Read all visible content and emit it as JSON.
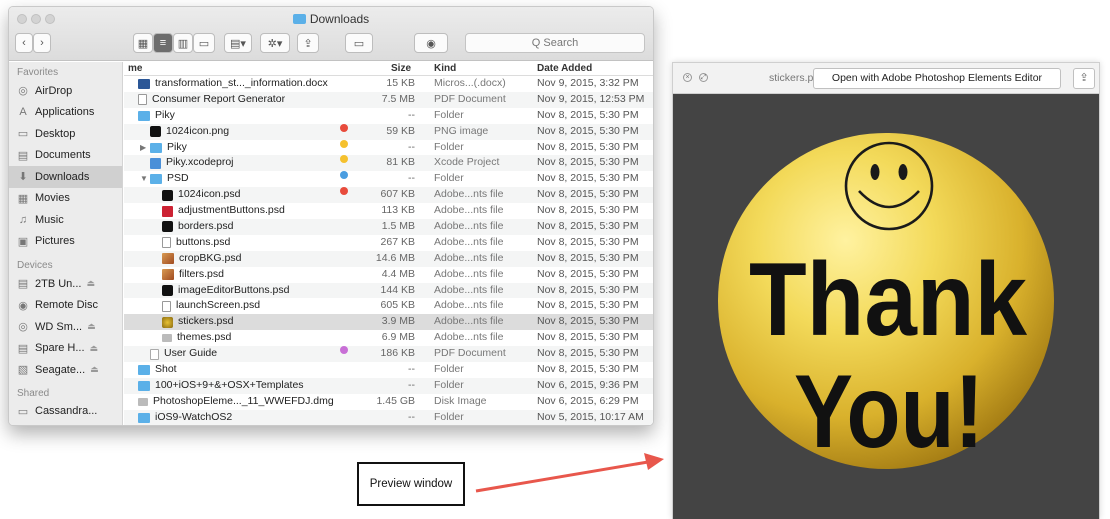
{
  "finder": {
    "title": "Downloads",
    "search_placeholder": "Q Search",
    "sidebar": {
      "favorites_label": "Favorites",
      "favorites": [
        {
          "label": "AirDrop",
          "icon": "airdrop-icon",
          "glyph": "◎"
        },
        {
          "label": "Applications",
          "icon": "applications-icon",
          "glyph": "A"
        },
        {
          "label": "Desktop",
          "icon": "desktop-icon",
          "glyph": "▭"
        },
        {
          "label": "Documents",
          "icon": "documents-icon",
          "glyph": "▤"
        },
        {
          "label": "Downloads",
          "icon": "downloads-icon",
          "glyph": "⬇",
          "selected": true
        },
        {
          "label": "Movies",
          "icon": "movies-icon",
          "glyph": "▦"
        },
        {
          "label": "Music",
          "icon": "music-icon",
          "glyph": "♫"
        },
        {
          "label": "Pictures",
          "icon": "pictures-icon",
          "glyph": "▣"
        }
      ],
      "devices_label": "Devices",
      "devices": [
        {
          "label": "2TB Un...",
          "icon": "drive-icon",
          "glyph": "▤",
          "eject": true
        },
        {
          "label": "Remote Disc",
          "icon": "remote-disc-icon",
          "glyph": "◉",
          "eject": false
        },
        {
          "label": "WD Sm...",
          "icon": "drive-icon",
          "glyph": "◎",
          "eject": true
        },
        {
          "label": "Spare H...",
          "icon": "drive-icon",
          "glyph": "▤",
          "eject": true
        },
        {
          "label": "Seagate...",
          "icon": "drive-icon",
          "glyph": "▧",
          "eject": true
        }
      ],
      "shared_label": "Shared",
      "shared": [
        {
          "label": "Cassandra...",
          "icon": "computer-icon",
          "glyph": "▭"
        }
      ]
    },
    "columns": {
      "name": "me",
      "size": "Size",
      "kind": "Kind",
      "date": "Date Added"
    },
    "rows": [
      {
        "indent": 0,
        "disc": "",
        "icon": "word",
        "name": "transformation_st..._information.docx",
        "size": "15 KB",
        "kind": "Micros...(.docx)",
        "date": "Nov 9, 2015, 3:32 PM",
        "tag": ""
      },
      {
        "indent": 0,
        "disc": "",
        "icon": "doc",
        "name": "Consumer Report Generator",
        "size": "7.5 MB",
        "kind": "PDF Document",
        "date": "Nov 9, 2015, 12:53 PM",
        "tag": ""
      },
      {
        "indent": 0,
        "disc": "",
        "icon": "folder",
        "name": "Piky",
        "size": "--",
        "kind": "Folder",
        "date": "Nov 8, 2015, 5:30 PM",
        "tag": ""
      },
      {
        "indent": 1,
        "disc": "",
        "icon": "dark",
        "name": "1024icon.png",
        "size": "59 KB",
        "kind": "PNG image",
        "date": "Nov 8, 2015, 5:30 PM",
        "tag": "#e84b3c"
      },
      {
        "indent": 1,
        "disc": "▶",
        "icon": "folder",
        "name": "Piky",
        "size": "--",
        "kind": "Folder",
        "date": "Nov 8, 2015, 5:30 PM",
        "tag": "#f5c12e"
      },
      {
        "indent": 1,
        "disc": "",
        "icon": "xcode",
        "name": "Piky.xcodeproj",
        "size": "81 KB",
        "kind": "Xcode Project",
        "date": "Nov 8, 2015, 5:30 PM",
        "tag": "#f5c12e"
      },
      {
        "indent": 1,
        "disc": "▼",
        "icon": "folder",
        "name": "PSD",
        "size": "--",
        "kind": "Folder",
        "date": "Nov 8, 2015, 5:30 PM",
        "tag": "#4a9de0"
      },
      {
        "indent": 2,
        "disc": "",
        "icon": "dark",
        "name": "1024icon.psd",
        "size": "607 KB",
        "kind": "Adobe...nts file",
        "date": "Nov 8, 2015, 5:30 PM",
        "tag": "#e84b3c"
      },
      {
        "indent": 2,
        "disc": "",
        "icon": "psd",
        "name": "adjustmentButtons.psd",
        "size": "113 KB",
        "kind": "Adobe...nts file",
        "date": "Nov 8, 2015, 5:30 PM",
        "tag": ""
      },
      {
        "indent": 2,
        "disc": "",
        "icon": "dark",
        "name": "borders.psd",
        "size": "1.5 MB",
        "kind": "Adobe...nts file",
        "date": "Nov 8, 2015, 5:30 PM",
        "tag": ""
      },
      {
        "indent": 2,
        "disc": "",
        "icon": "doc",
        "name": "buttons.psd",
        "size": "267 KB",
        "kind": "Adobe...nts file",
        "date": "Nov 8, 2015, 5:30 PM",
        "tag": ""
      },
      {
        "indent": 2,
        "disc": "",
        "icon": "photo",
        "name": "cropBKG.psd",
        "size": "14.6 MB",
        "kind": "Adobe...nts file",
        "date": "Nov 8, 2015, 5:30 PM",
        "tag": ""
      },
      {
        "indent": 2,
        "disc": "",
        "icon": "photo",
        "name": "filters.psd",
        "size": "4.4 MB",
        "kind": "Adobe...nts file",
        "date": "Nov 8, 2015, 5:30 PM",
        "tag": ""
      },
      {
        "indent": 2,
        "disc": "",
        "icon": "dark",
        "name": "imageEditorButtons.psd",
        "size": "144 KB",
        "kind": "Adobe...nts file",
        "date": "Nov 8, 2015, 5:30 PM",
        "tag": ""
      },
      {
        "indent": 2,
        "disc": "",
        "icon": "doc",
        "name": "launchScreen.psd",
        "size": "605 KB",
        "kind": "Adobe...nts file",
        "date": "Nov 8, 2015, 5:30 PM",
        "tag": ""
      },
      {
        "indent": 2,
        "disc": "",
        "icon": "gold",
        "name": "stickers.psd",
        "size": "3.9 MB",
        "kind": "Adobe...nts file",
        "date": "Nov 8, 2015, 5:30 PM",
        "tag": "",
        "selected": true
      },
      {
        "indent": 2,
        "disc": "",
        "icon": "dmg",
        "name": "themes.psd",
        "size": "6.9 MB",
        "kind": "Adobe...nts file",
        "date": "Nov 8, 2015, 5:30 PM",
        "tag": ""
      },
      {
        "indent": 1,
        "disc": "",
        "icon": "pdf",
        "name": "User Guide",
        "size": "186 KB",
        "kind": "PDF Document",
        "date": "Nov 8, 2015, 5:30 PM",
        "tag": "#c86fd6"
      },
      {
        "indent": 0,
        "disc": "",
        "icon": "folder",
        "name": "Shot",
        "size": "--",
        "kind": "Folder",
        "date": "Nov 8, 2015, 5:30 PM",
        "tag": ""
      },
      {
        "indent": 0,
        "disc": "",
        "icon": "folder",
        "name": "100+iOS+9+&+OSX+Templates",
        "size": "--",
        "kind": "Folder",
        "date": "Nov 6, 2015, 9:36 PM",
        "tag": ""
      },
      {
        "indent": 0,
        "disc": "",
        "icon": "dmg",
        "name": "PhotoshopEleme..._11_WWEFDJ.dmg",
        "size": "1.45 GB",
        "kind": "Disk Image",
        "date": "Nov 6, 2015, 6:29 PM",
        "tag": ""
      },
      {
        "indent": 0,
        "disc": "",
        "icon": "folder",
        "name": "iOS9-WatchOS2",
        "size": "--",
        "kind": "Folder",
        "date": "Nov 5, 2015, 10:17 AM",
        "tag": ""
      }
    ]
  },
  "preview": {
    "filename": "stickers.psd",
    "open_button": "Open with Adobe Photoshop Elements Editor",
    "sticker": {
      "line1": "Thank",
      "line2": "You!"
    },
    "colors": {
      "gold_light": "#f3da5a",
      "gold_dark": "#9c7410",
      "background": "#444444"
    }
  },
  "annotation": {
    "label": "Preview window",
    "arrow_color": "#e8574c"
  }
}
